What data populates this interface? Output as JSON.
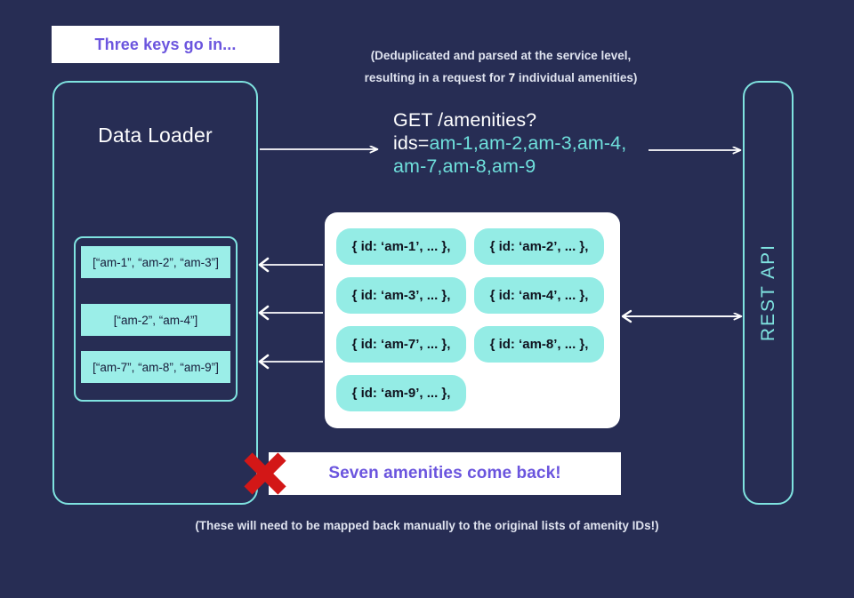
{
  "banners": {
    "top": "Three keys go in...",
    "bottom": "Seven amenities come back!"
  },
  "data_loader": {
    "title": "Data Loader",
    "keys": [
      "[“am-1”, “am-2”, “am-3”]",
      "[“am-2”, “am-4”]",
      "[“am-7”, “am-8”, “am-9”]"
    ]
  },
  "request": {
    "note_line1": "(Deduplicated and parsed at the service level,",
    "note_line2_before": "resulting in a request for ",
    "note_count": "7",
    "note_line2_after": " individual amenities)",
    "method_path": "GET /amenities?",
    "query_key": "ids=",
    "ids_line1": "am-1,am-2,am-3,am-4,",
    "ids_line2": "am-7,am-8,am-9"
  },
  "response": {
    "pills": [
      "{ id: ‘am-1’, ... },",
      "{ id: ‘am-2’, ... },",
      "{ id: ‘am-3’, ... },",
      "{ id: ‘am-4’, ... },",
      "{ id: ‘am-7’, ... },",
      "{ id: ‘am-8’, ... },",
      "{ id: ‘am-9’, ... },"
    ]
  },
  "rest_api": {
    "label": "REST API"
  },
  "footer": {
    "caption": "(These will need to be mapped back manually to the original lists of amenity IDs!)"
  },
  "colors": {
    "background": "#272d54",
    "accent_cyan": "#7fe3e0",
    "pill_cyan": "#94ece5",
    "purple_text": "#6b55de",
    "error_red": "#d31717",
    "white": "#ffffff"
  }
}
